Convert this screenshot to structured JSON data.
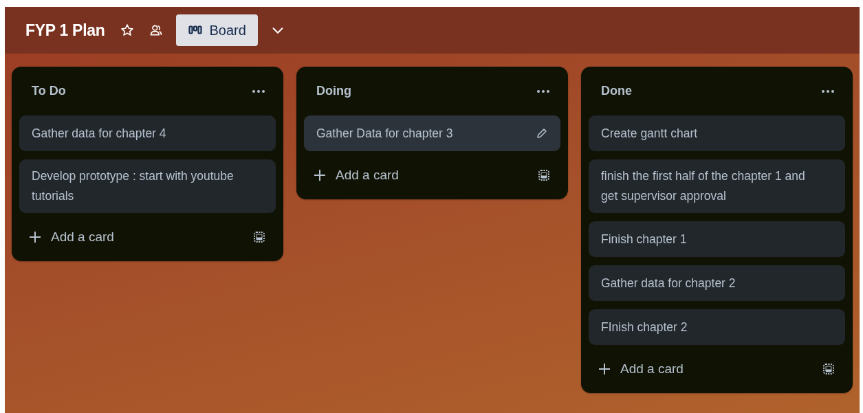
{
  "board": {
    "title": "FYP 1 Plan",
    "starred": false,
    "view": {
      "label": "Board"
    }
  },
  "lists": [
    {
      "title": "To Do",
      "cards": [
        {
          "title": "Gather data for chapter 4",
          "hovered": false
        },
        {
          "title": "Develop prototype : start with youtube tutorials",
          "hovered": false
        }
      ],
      "add_label": "Add a card"
    },
    {
      "title": "Doing",
      "cards": [
        {
          "title": "Gather Data for chapter 3",
          "hovered": true
        }
      ],
      "add_label": "Add a card"
    },
    {
      "title": "Done",
      "cards": [
        {
          "title": "Create gantt chart",
          "hovered": false
        },
        {
          "title": "finish the first half of the chapter 1 and get supervisor approval",
          "hovered": false
        },
        {
          "title": "Finish chapter 1",
          "hovered": false
        },
        {
          "title": "Gather data for chapter 2",
          "hovered": false
        },
        {
          "title": "FInish chapter 2",
          "hovered": false
        }
      ],
      "add_label": "Add a card"
    }
  ]
}
